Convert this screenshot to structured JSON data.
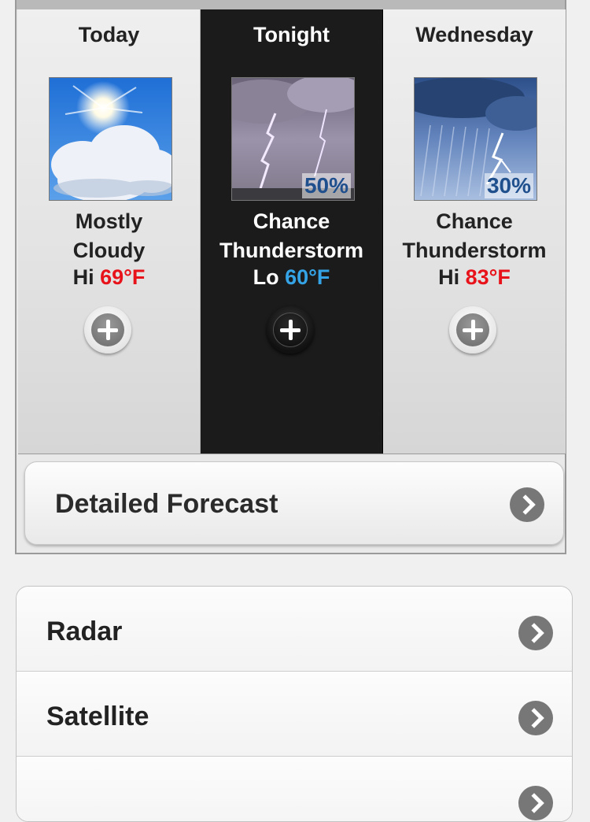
{
  "forecast": {
    "periods": [
      {
        "name": "Today",
        "condition_line1": "Mostly",
        "condition_line2": "Cloudy",
        "temp_prefix": "Hi",
        "temp_value": "69°F",
        "temp_type": "hi",
        "icon": "mostly-cloudy-icon",
        "precip_chance": ""
      },
      {
        "name": "Tonight",
        "condition_line1": "Chance",
        "condition_line2": "Thunderstorm",
        "temp_prefix": "Lo",
        "temp_value": "60°F",
        "temp_type": "lo",
        "icon": "thunderstorm-icon",
        "precip_chance": "50%"
      },
      {
        "name": "Wednesday",
        "condition_line1": "Chance",
        "condition_line2": "Thunderstorm",
        "temp_prefix": "Hi",
        "temp_value": "83°F",
        "temp_type": "hi",
        "icon": "rain-lightning-icon",
        "precip_chance": "30%"
      }
    ],
    "selected_period": "Tonight",
    "detail_label": "Detailed Forecast"
  },
  "menu": {
    "items": [
      {
        "label": "Radar"
      },
      {
        "label": "Satellite"
      },
      {
        "label": ""
      }
    ]
  },
  "colors": {
    "hi_temp": "#e8131a",
    "lo_temp": "#35a4e6",
    "selected_background": "#1b1b1b"
  }
}
